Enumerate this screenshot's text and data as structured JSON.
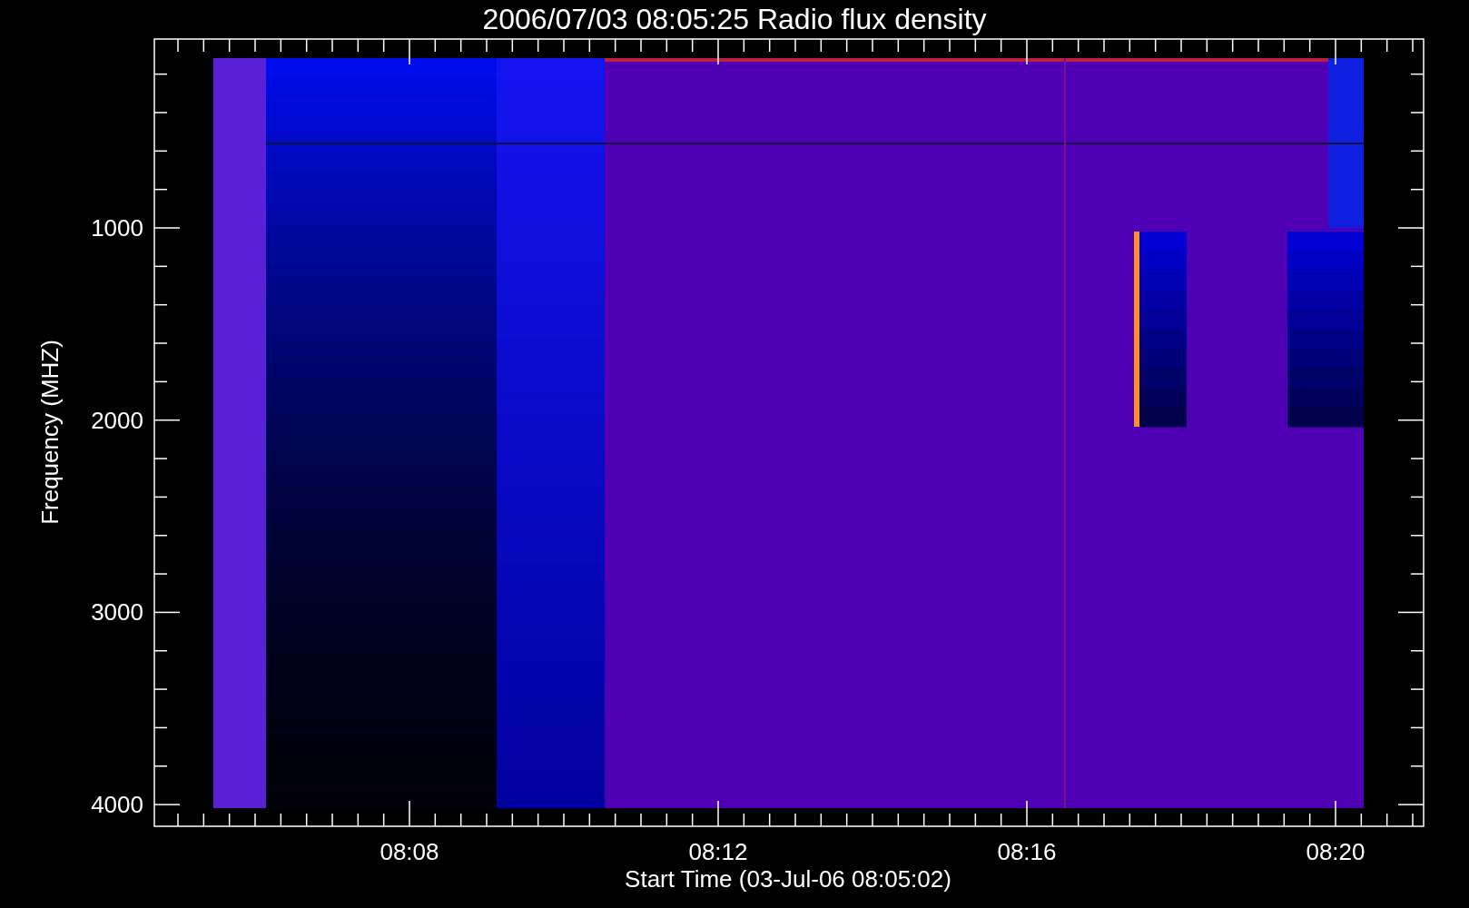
{
  "plot": {
    "title": "2006/07/03 08:05:25 Radio flux density",
    "y_axis": {
      "label": "Frequency (MHZ)",
      "ticks": [
        "1000",
        "2000",
        "3000",
        "4000"
      ]
    },
    "x_axis": {
      "label": "Start Time (03-Jul-06 08:05:02)",
      "ticks": [
        "08:08",
        "08:12",
        "08:16",
        "08:20"
      ]
    }
  }
}
